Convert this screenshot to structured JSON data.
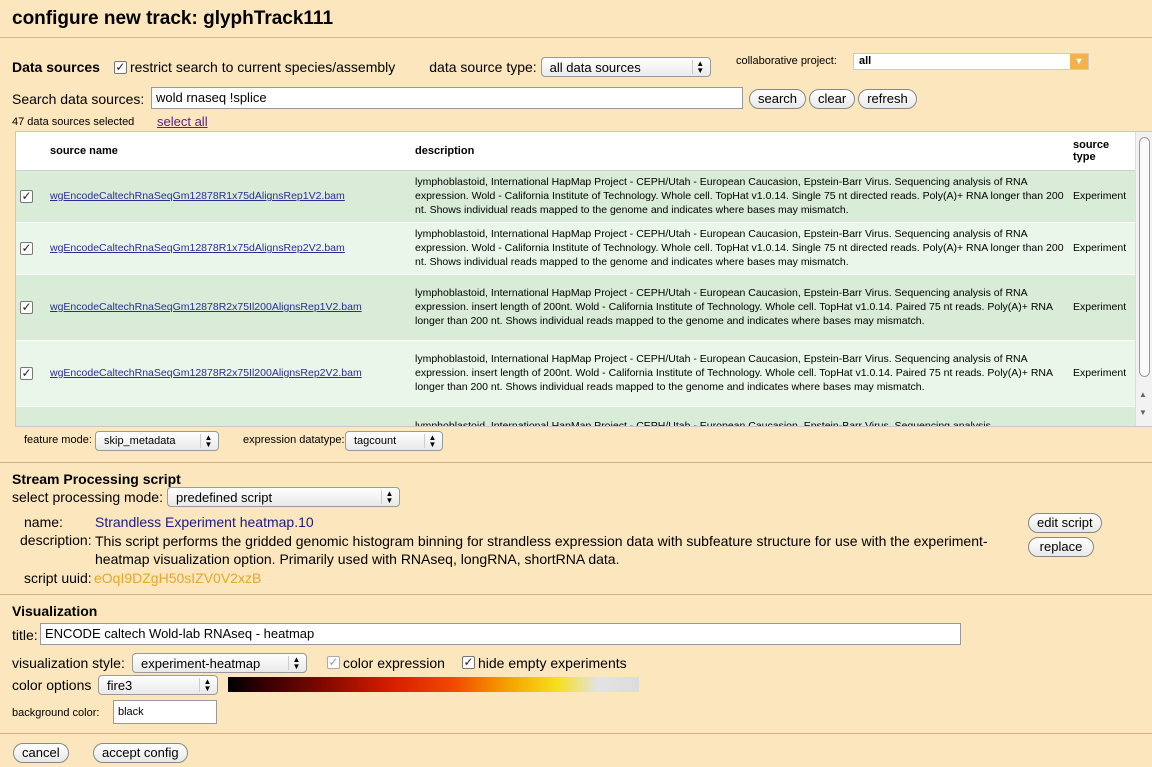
{
  "title": "configure new track: glyphTrack111",
  "datasources": {
    "header": "Data sources",
    "restrict_label": "restrict search to current species/assembly",
    "type_label": "data source type:",
    "type_value": "all data sources",
    "collab_label": "collaborative project:",
    "collab_value": "all",
    "search_label": "Search data sources:",
    "search_value": "wold rnaseq !splice",
    "search_btn": "search",
    "clear_btn": "clear",
    "refresh_btn": "refresh",
    "selected_count": "47 data sources selected",
    "select_all": "select all",
    "columns": {
      "name": "source name",
      "desc": "description",
      "type": "source type"
    },
    "rows": [
      {
        "name": "wgEncodeCaltechRnaSeqGm12878R1x75dAlignsRep1V2.bam",
        "desc": "lymphoblastoid, International HapMap Project - CEPH/Utah - European Caucasion, Epstein-Barr Virus. Sequencing analysis of RNA expression. Wold - California Institute of Technology. Whole cell. TopHat v1.0.14. Single 75 nt directed reads. Poly(A)+ RNA longer than 200 nt. Shows individual reads mapped to the genome and indicates where bases may mismatch.",
        "type": "Experiment"
      },
      {
        "name": "wgEncodeCaltechRnaSeqGm12878R1x75dAlignsRep2V2.bam",
        "desc": "lymphoblastoid, International HapMap Project - CEPH/Utah - European Caucasion, Epstein-Barr Virus. Sequencing analysis of RNA expression. Wold - California Institute of Technology. Whole cell. TopHat v1.0.14. Single 75 nt directed reads. Poly(A)+ RNA longer than 200 nt. Shows individual reads mapped to the genome and indicates where bases may mismatch.",
        "type": "Experiment"
      },
      {
        "name": "wgEncodeCaltechRnaSeqGm12878R2x75Il200AlignsRep1V2.bam",
        "desc": "lymphoblastoid, International HapMap Project - CEPH/Utah - European Caucasion, Epstein-Barr Virus. Sequencing analysis of RNA expression. insert length of 200nt. Wold - California Institute of Technology. Whole cell. TopHat v1.0.14. Paired 75 nt reads. Poly(A)+ RNA longer than 200 nt. Shows individual reads mapped to the genome and indicates where bases may mismatch.",
        "type": "Experiment"
      },
      {
        "name": "wgEncodeCaltechRnaSeqGm12878R2x75Il200AlignsRep2V2.bam",
        "desc": "lymphoblastoid, International HapMap Project - CEPH/Utah - European Caucasion, Epstein-Barr Virus. Sequencing analysis of RNA expression. insert length of 200nt. Wold - California Institute of Technology. Whole cell. TopHat v1.0.14. Paired 75 nt reads. Poly(A)+ RNA longer than 200 nt. Shows individual reads mapped to the genome and indicates where bases may mismatch.",
        "type": "Experiment"
      },
      {
        "name": "",
        "desc": "lymphoblastoid, International HapMap Project - CEPH/Utah - European Caucasion, Epstein-Barr Virus. Sequencing analysis",
        "type": ""
      }
    ],
    "feature_mode_label": "feature mode:",
    "feature_mode_value": "skip_metadata",
    "expr_label": "expression datatype:",
    "expr_value": "tagcount"
  },
  "stream": {
    "header": "Stream Processing script",
    "mode_label": "select processing mode:",
    "mode_value": "predefined script",
    "name_label": "name:",
    "name_value": "Strandless Experiment heatmap.10",
    "desc_label": "description:",
    "desc_value": "This script performs the gridded genomic histogram binning for strandless expression data with subfeature structure for use with the experiment-heatmap visualization option. Primarily used with RNAseq, longRNA, shortRNA data.",
    "uuid_label": "script uuid:",
    "uuid_value": "eOqI9DZgH50sIZV0V2xzB",
    "edit_btn": "edit script",
    "replace_btn": "replace"
  },
  "viz": {
    "header": "Visualization",
    "title_label": "title:",
    "title_value": "ENCODE caltech Wold-lab RNAseq - heatmap",
    "style_label": "visualization style:",
    "style_value": "experiment-heatmap",
    "color_expr_label": "color expression",
    "hide_empty_label": "hide empty experiments",
    "color_opt_label": "color options",
    "color_opt_value": "fire3",
    "bg_label": "background color:",
    "bg_value": "black"
  },
  "footer": {
    "cancel": "cancel",
    "accept": "accept config"
  }
}
